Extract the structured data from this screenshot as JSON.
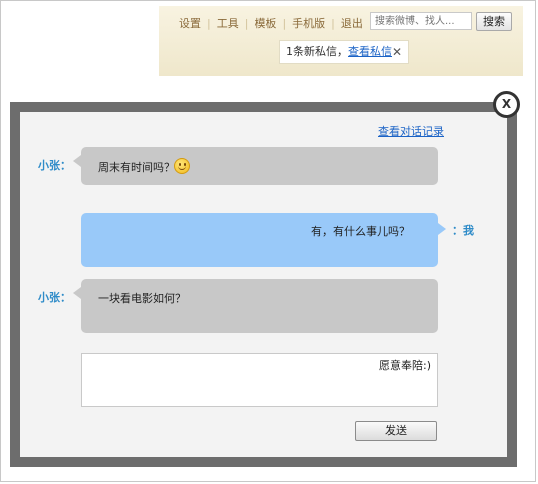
{
  "topbar": {
    "nav": [
      "设置",
      "工具",
      "模板",
      "手机版",
      "退出"
    ],
    "search": {
      "placeholder": "搜索微博、找人...",
      "button_label": "搜索"
    },
    "notice": {
      "text": "1条新私信，",
      "link_label": "查看私信",
      "close_glyph": "✕"
    }
  },
  "dialog": {
    "close_label": "X",
    "history_link": "查看对话记录",
    "messages": [
      {
        "speaker": "小张：",
        "text": "周末有时间吗？",
        "side": "other",
        "emoji": "smiley-icon"
      },
      {
        "speaker": "：我",
        "text": "有，有什么事儿吗？",
        "side": "me"
      },
      {
        "speaker": "小张：",
        "text": "一块看电影如何？",
        "side": "other"
      }
    ],
    "reply_value": "愿意奉陪:)",
    "send_label": "发送"
  },
  "colors": {
    "topbar_bg": "#f5efd9",
    "link": "#1b63c6",
    "speaker": "#2e8bc8",
    "bubble_other": "#c8c8c8",
    "bubble_me": "#99c9f9",
    "dialog_border": "#6d6d6d"
  }
}
